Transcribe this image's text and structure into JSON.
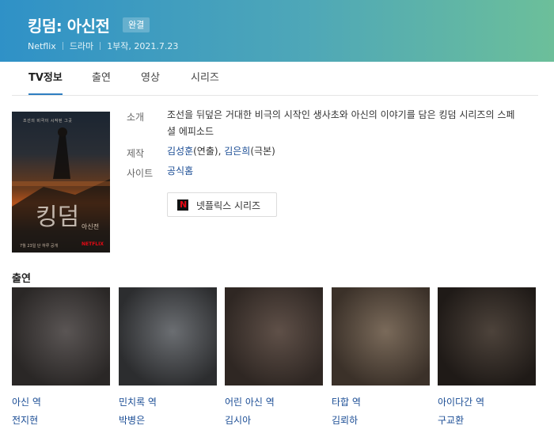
{
  "header": {
    "title": "킹덤: 아신전",
    "badge": "완결",
    "meta": [
      "Netflix",
      "드라마",
      "1부작, 2021.7.23"
    ]
  },
  "tabs": [
    {
      "label": "TV정보",
      "active": true
    },
    {
      "label": "출연",
      "active": false
    },
    {
      "label": "영상",
      "active": false
    },
    {
      "label": "시리즈",
      "active": false
    }
  ],
  "poster": {
    "title_text": "킹덤",
    "subtitle_text": "아신전",
    "top_text": "조선의 비극이 시작된 그곳",
    "footer_text": "7월 23일 단 하루 공개",
    "brand_text": "NETFLIX"
  },
  "info": {
    "intro_label": "소개",
    "intro_text": "조선을 뒤덮은 거대한 비극의 시작인 생사초와 아신의 이야기를 담은 킹덤 시리즈의 스페셜 에피소드",
    "production_label": "제작",
    "director": "김성훈",
    "director_role": "(연출)",
    "separator": ", ",
    "writer": "김은희",
    "writer_role": "(극본)",
    "site_label": "사이트",
    "site_link": "공식홈"
  },
  "netflix_button": {
    "icon_letter": "N",
    "label": "넷플릭스 시리즈"
  },
  "cast_section": {
    "title": "출연",
    "members": [
      {
        "role": "아신 역",
        "name": "전지현",
        "colors": [
          "#5a5554",
          "#2a2726"
        ]
      },
      {
        "role": "민치록 역",
        "name": "박병은",
        "colors": [
          "#6b6e72",
          "#2c2d2f"
        ]
      },
      {
        "role": "어린 아신 역",
        "name": "김시아",
        "colors": [
          "#5f5048",
          "#2f2723"
        ]
      },
      {
        "role": "타합 역",
        "name": "김뢰하",
        "colors": [
          "#7a6a5a",
          "#3b3129"
        ]
      },
      {
        "role": "아이다간 역",
        "name": "구교환",
        "colors": [
          "#4d433b",
          "#1f1a17"
        ]
      }
    ]
  }
}
